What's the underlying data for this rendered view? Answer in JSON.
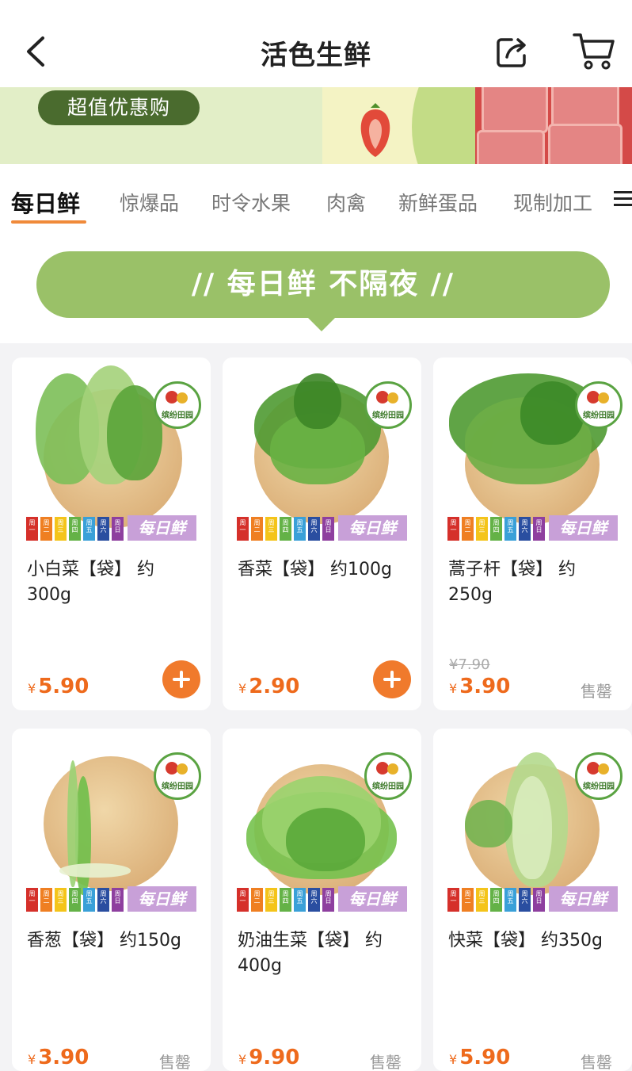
{
  "header": {
    "title": "活色生鲜",
    "back_icon": "chevron-left-icon",
    "share_icon": "share-icon",
    "cart_icon": "cart-icon"
  },
  "banner": {
    "promo_label": "超值优惠购"
  },
  "tabs": [
    {
      "label": "每日鲜",
      "active": true
    },
    {
      "label": "惊爆品",
      "active": false
    },
    {
      "label": "时令水果",
      "active": false
    },
    {
      "label": "肉禽",
      "active": false
    },
    {
      "label": "新鲜蛋品",
      "active": false
    },
    {
      "label": "现制加工",
      "active": false
    }
  ],
  "tabs_menu_icon": "menu-icon",
  "section": {
    "title": "// 每日鲜 不隔夜 //"
  },
  "week_strip": {
    "days": [
      "周一",
      "周二",
      "周三",
      "周四",
      "周五",
      "周六",
      "周日"
    ],
    "colors": [
      "#d5302a",
      "#ef7f22",
      "#f4c41a",
      "#64b247",
      "#3aa0d8",
      "#2a4ea0",
      "#8e3f9f"
    ],
    "label": "每日鲜"
  },
  "brand_badge": "缤纷田园",
  "products": [
    {
      "name": "小白菜【袋】 约300g",
      "currency": "¥",
      "price": "5.90",
      "old_price": null,
      "action": "add"
    },
    {
      "name": "香菜【袋】 约100g",
      "currency": "¥",
      "price": "2.90",
      "old_price": null,
      "action": "add"
    },
    {
      "name": "蒿子杆【袋】 约250g",
      "currency": "¥",
      "price": "3.90",
      "old_price": "¥7.90",
      "action": "售罄"
    },
    {
      "name": "香葱【袋】 约150g",
      "currency": "¥",
      "price": "3.90",
      "old_price": null,
      "action": "售罄"
    },
    {
      "name": "奶油生菜【袋】 约400g",
      "currency": "¥",
      "price": "9.90",
      "old_price": null,
      "action": "售罄"
    },
    {
      "name": "快菜【袋】 约350g",
      "currency": "¥",
      "price": "5.90",
      "old_price": null,
      "action": "售罄"
    }
  ],
  "colors": {
    "accent": "#f07a2c",
    "price": "#ee6a1c",
    "section_green": "#9ac168",
    "promo_pill": "#4a6b2e"
  }
}
